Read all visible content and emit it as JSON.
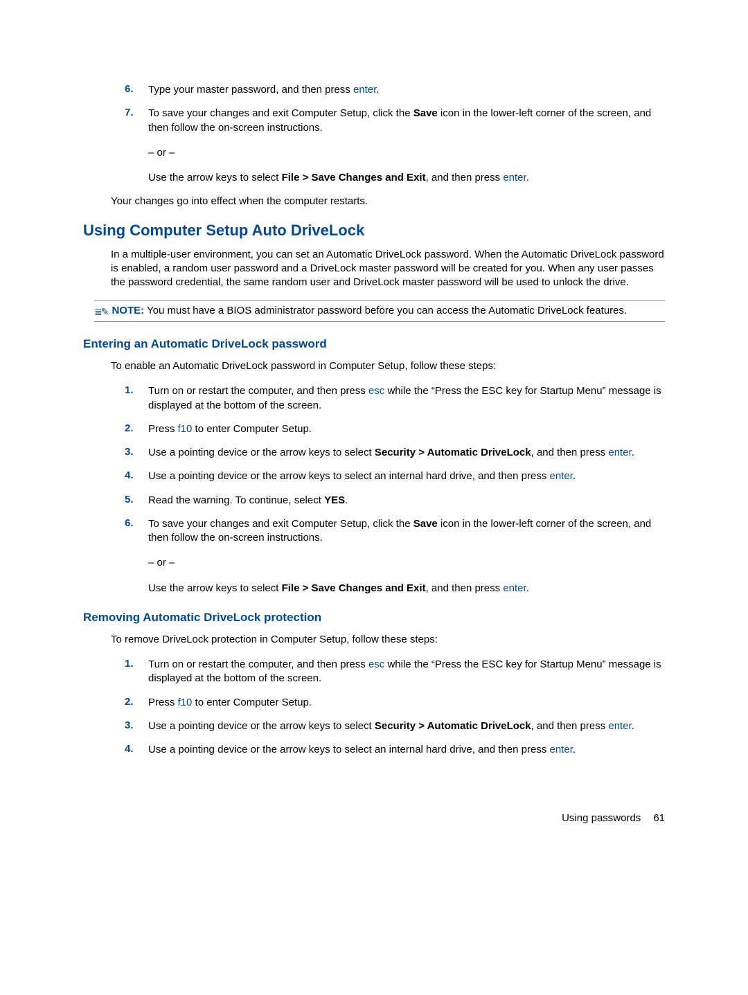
{
  "top_steps": {
    "s6": {
      "text_a": "Type your master password, and then press ",
      "key": "enter",
      "text_b": "."
    },
    "s7": {
      "p1_a": "To save your changes and exit Computer Setup, click the ",
      "p1_bold": "Save",
      "p1_b": " icon in the lower-left corner of the screen, and then follow the on-screen instructions.",
      "or": "– or –",
      "p2_a": "Use the arrow keys to select ",
      "p2_bold": "File > Save Changes and Exit",
      "p2_b": ", and then press ",
      "p2_key": "enter",
      "p2_c": "."
    }
  },
  "restart_effect": "Your changes go into effect when the computer restarts.",
  "section_title": "Using Computer Setup Auto DriveLock",
  "section_body": "In a multiple-user environment, you can set an Automatic DriveLock password. When the Automatic DriveLock password is enabled, a random user password and a DriveLock master password will be created for you. When any user passes the password credential, the same random user and DriveLock master password will be used to unlock the drive.",
  "note": {
    "label": "NOTE:",
    "text": "   You must have a BIOS administrator password before you can access the Automatic DriveLock features."
  },
  "sub1": {
    "title": "Entering an Automatic DriveLock password",
    "intro": "To enable an Automatic DriveLock password in Computer Setup, follow these steps:",
    "s1_a": "Turn on or restart the computer, and then press ",
    "s1_key": "esc",
    "s1_b": " while the “Press the ESC key for Startup Menu” message is displayed at the bottom of the screen.",
    "s2_a": "Press ",
    "s2_key": "f10",
    "s2_b": " to enter Computer Setup.",
    "s3_a": "Use a pointing device or the arrow keys to select ",
    "s3_bold": "Security > Automatic DriveLock",
    "s3_b": ", and then press ",
    "s3_key": "enter",
    "s3_c": ".",
    "s4_a": "Use a pointing device or the arrow keys to select an internal hard drive, and then press ",
    "s4_key": "enter",
    "s4_b": ".",
    "s5_a": "Read the warning. To continue, select ",
    "s5_bold": "YES",
    "s5_b": ".",
    "s6_p1_a": "To save your changes and exit Computer Setup, click the ",
    "s6_p1_bold": "Save",
    "s6_p1_b": " icon in the lower-left corner of the screen, and then follow the on-screen instructions.",
    "s6_or": "– or –",
    "s6_p2_a": "Use the arrow keys to select ",
    "s6_p2_bold": "File > Save Changes and Exit",
    "s6_p2_b": ", and then press ",
    "s6_p2_key": "enter",
    "s6_p2_c": "."
  },
  "sub2": {
    "title": "Removing Automatic DriveLock protection",
    "intro": "To remove DriveLock protection in Computer Setup, follow these steps:",
    "s1_a": "Turn on or restart the computer, and then press ",
    "s1_key": "esc",
    "s1_b": " while the “Press the ESC key for Startup Menu” message is displayed at the bottom of the screen.",
    "s2_a": "Press ",
    "s2_key": "f10",
    "s2_b": " to enter Computer Setup.",
    "s3_a": "Use a pointing device or the arrow keys to select ",
    "s3_bold": "Security > Automatic DriveLock",
    "s3_b": ", and then press ",
    "s3_key": "enter",
    "s3_c": ".",
    "s4_a": "Use a pointing device or the arrow keys to select an internal hard drive, and then press ",
    "s4_key": "enter",
    "s4_b": "."
  },
  "footer": {
    "label": "Using passwords",
    "page": "61"
  },
  "numbers": {
    "n1": "1.",
    "n2": "2.",
    "n3": "3.",
    "n4": "4.",
    "n5": "5.",
    "n6": "6.",
    "n7": "7."
  }
}
